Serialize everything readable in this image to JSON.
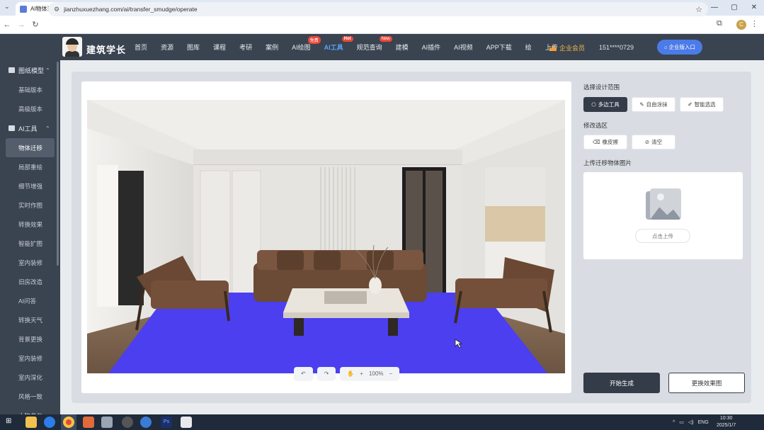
{
  "browser": {
    "tab_title": "AI物体迁移",
    "url": "jianzhuxuezhang.com/ai/transfer_smudge/operate",
    "profile_initial": "C"
  },
  "header": {
    "brand": "建筑学长",
    "nav": [
      {
        "label": "首页",
        "active": false,
        "badge": ""
      },
      {
        "label": "资源",
        "active": false,
        "badge": ""
      },
      {
        "label": "图库",
        "active": false,
        "badge": ""
      },
      {
        "label": "课程",
        "active": false,
        "badge": ""
      },
      {
        "label": "考研",
        "active": false,
        "badge": ""
      },
      {
        "label": "案例",
        "active": false,
        "badge": ""
      },
      {
        "label": "AI绘图",
        "active": false,
        "badge": "免费"
      },
      {
        "label": "AI工具",
        "active": true,
        "badge": "Hot"
      },
      {
        "label": "规范查询",
        "active": false,
        "badge": "New"
      },
      {
        "label": "建模",
        "active": false,
        "badge": ""
      },
      {
        "label": "AI插件",
        "active": false,
        "badge": ""
      },
      {
        "label": "AI视频",
        "active": false,
        "badge": ""
      },
      {
        "label": "APP下载",
        "active": false,
        "badge": ""
      },
      {
        "label": "绘",
        "active": false,
        "badge": ""
      },
      {
        "label": "上传",
        "active": false,
        "badge": ""
      }
    ],
    "vip_label": "企业会员",
    "phone": "151****0729",
    "enterprise_btn": "企业版入口"
  },
  "sidebar": {
    "groups": [
      {
        "label": "图纸模型",
        "items": [
          "基础版本",
          "高级版本"
        ]
      },
      {
        "label": "AI工具",
        "items": [
          "物体迁移",
          "局部重绘",
          "细节增强",
          "实时作图",
          "转换效果",
          "智能扩图",
          "室内装修",
          "旧房改造",
          "AI问答",
          "转换天气",
          "背景更换",
          "室内装修",
          "室内深化",
          "风格一致",
          "人物参与"
        ]
      }
    ],
    "active_item": "物体迁移"
  },
  "canvas": {
    "undo_label": "↶",
    "redo_label": "↷",
    "zoom": "100%"
  },
  "panel": {
    "range_title": "选择设计范围",
    "tools": [
      "多边工具",
      "自由涂抹",
      "智能选选"
    ],
    "modify_title": "修改选区",
    "modify_tools": [
      "橡皮擦",
      "清空"
    ],
    "upload_title": "上传迁移物体图片",
    "upload_btn": "点击上传",
    "generate_btn": "开始生成",
    "swap_btn": "更换效果图"
  },
  "taskbar": {
    "time": "10:30",
    "date": "2025/1/7",
    "lang": "ENG"
  }
}
